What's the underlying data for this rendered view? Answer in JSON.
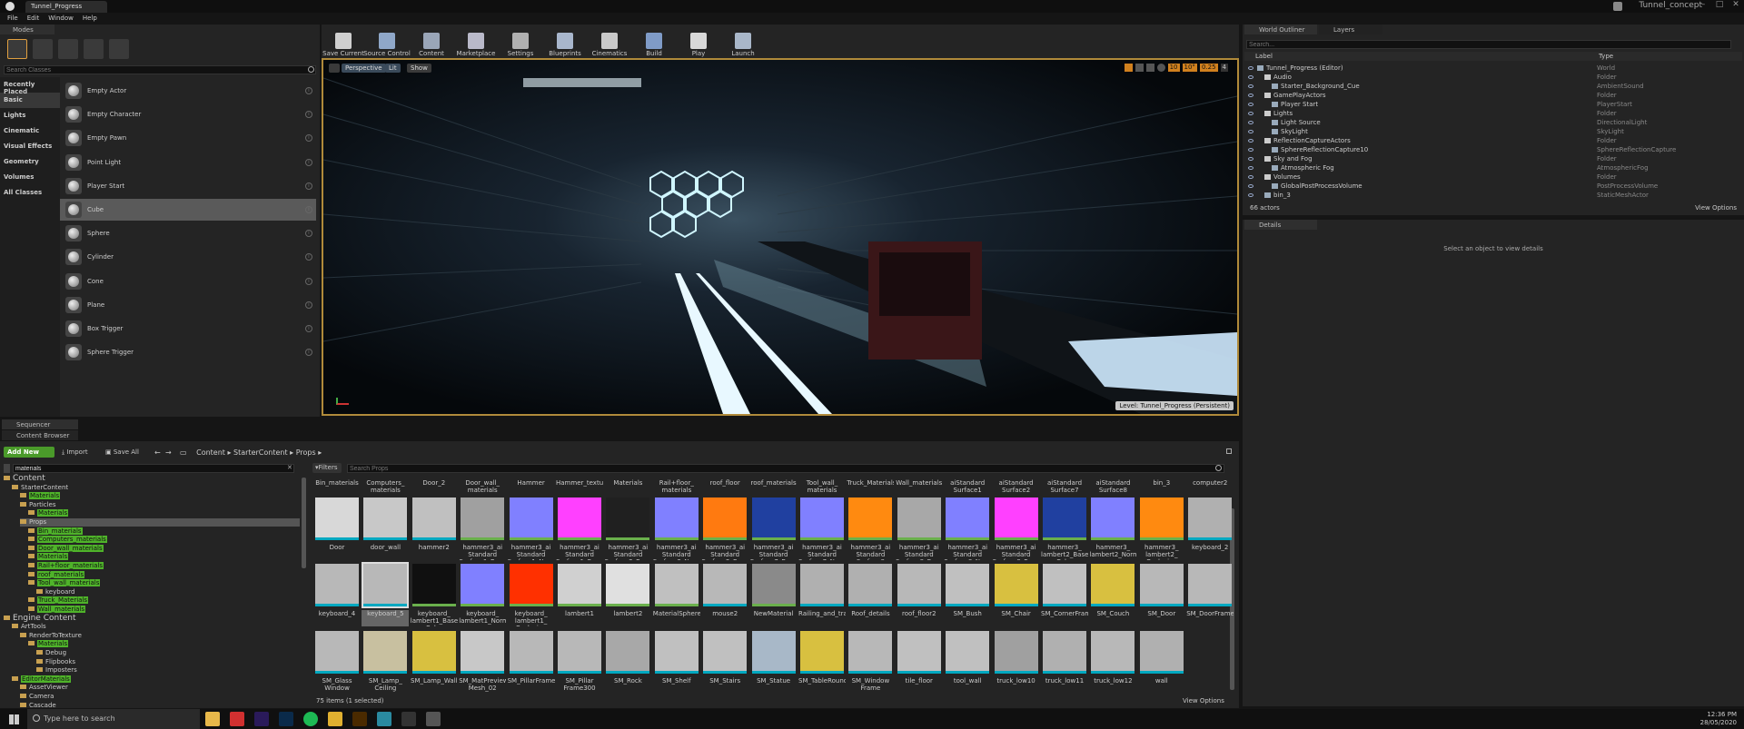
{
  "window": {
    "tab_title": "Tunnel_Progress",
    "project": "Tunnel_concept",
    "min": "–",
    "max": "□",
    "close": "✕"
  },
  "menu": [
    "File",
    "Edit",
    "Window",
    "Help"
  ],
  "modes": {
    "tab": "Modes",
    "search_placeholder": "Search Classes",
    "categories": [
      "Recently Placed",
      "Basic",
      "Lights",
      "Cinematic",
      "Visual Effects",
      "Geometry",
      "Volumes",
      "All Classes"
    ],
    "actors": [
      "Empty Actor",
      "Empty Character",
      "Empty Pawn",
      "Point Light",
      "Player Start",
      "Cube",
      "Sphere",
      "Cylinder",
      "Cone",
      "Plane",
      "Box Trigger",
      "Sphere Trigger"
    ]
  },
  "toolbar": [
    {
      "label": "Save Current",
      "color": "#cfcfcf"
    },
    {
      "label": "Source Control",
      "color": "#8fa7c8"
    },
    {
      "label": "Content",
      "color": "#9aa6b8"
    },
    {
      "label": "Marketplace",
      "color": "#b9b9c9"
    },
    {
      "label": "Settings",
      "color": "#b0b0b0"
    },
    {
      "label": "Blueprints",
      "color": "#a8b6cc"
    },
    {
      "label": "Cinematics",
      "color": "#c9c9c9"
    },
    {
      "label": "Build",
      "color": "#7f9bc7"
    },
    {
      "label": "Play",
      "color": "#d8d8d8"
    },
    {
      "label": "Launch",
      "color": "#a9b7c9"
    }
  ],
  "viewport": {
    "perspective": "Perspective",
    "lit": "Lit",
    "show": "Show",
    "level_label": "Level:",
    "level_name": "Tunnel_Progress (Persistent)",
    "snap": [
      "10",
      "10°",
      "0.25",
      "4"
    ]
  },
  "outliner": {
    "tab": "World Outliner",
    "tab2": "Layers",
    "search_placeholder": "Search...",
    "col_label": "Label",
    "col_type": "Type",
    "count": "66 actors",
    "view_options": "View Options",
    "rows": [
      {
        "label": "Tunnel_Progress (Editor)",
        "type": "World",
        "indent": 0
      },
      {
        "label": "Audio",
        "type": "Folder",
        "indent": 1
      },
      {
        "label": "Starter_Background_Cue",
        "type": "AmbientSound",
        "indent": 2
      },
      {
        "label": "GamePlayActors",
        "type": "Folder",
        "indent": 1
      },
      {
        "label": "Player Start",
        "type": "PlayerStart",
        "indent": 2
      },
      {
        "label": "Lights",
        "type": "Folder",
        "indent": 1
      },
      {
        "label": "Light Source",
        "type": "DirectionalLight",
        "indent": 2
      },
      {
        "label": "SkyLight",
        "type": "SkyLight",
        "indent": 2
      },
      {
        "label": "ReflectionCaptureActors",
        "type": "Folder",
        "indent": 1
      },
      {
        "label": "SphereReflectionCapture10",
        "type": "SphereReflectionCapture",
        "indent": 2
      },
      {
        "label": "Sky and Fog",
        "type": "Folder",
        "indent": 1
      },
      {
        "label": "Atmospheric Fog",
        "type": "AtmosphericFog",
        "indent": 2
      },
      {
        "label": "Volumes",
        "type": "Folder",
        "indent": 1
      },
      {
        "label": "GlobalPostProcessVolume",
        "type": "PostProcessVolume",
        "indent": 2
      },
      {
        "label": "bin_3",
        "type": "StaticMeshActor",
        "indent": 1
      }
    ]
  },
  "details": {
    "tab": "Details",
    "empty": "Select an object to view details"
  },
  "bottom_tabs": [
    "Sequencer",
    "Content Browser"
  ],
  "cb": {
    "add_new": "Add New",
    "import": "Import",
    "save_all": "Save All",
    "path": [
      "Content",
      "StarterContent",
      "Props"
    ],
    "filters": "Filters",
    "search_placeholder": "Search Props",
    "tree_search": "materials",
    "status": "75 items (1 selected)",
    "view_options": "View Options",
    "folders": [
      "Bin_materials",
      "Computers_ materials",
      "Door_2",
      "Door_wall_ materials",
      "Hammer",
      "Hammer_textures",
      "Materials",
      "Rail+floor_ materials",
      "roof_floor",
      "roof_materials",
      "Tool_wall_ materials",
      "Truck_Materials",
      "Wall_materials",
      "aiStandard Surface1",
      "aiStandard Surface2",
      "aiStandard Surface7",
      "aiStandard Surface8",
      "bin_3",
      "computer2"
    ]
  },
  "tree": [
    {
      "t": "Content",
      "lvl": 0,
      "big": true
    },
    {
      "t": "StarterContent",
      "lvl": 1
    },
    {
      "t": "Materials",
      "lvl": 2,
      "hl": true
    },
    {
      "t": "Particles",
      "lvl": 2
    },
    {
      "t": "Materials",
      "lvl": 3,
      "hl": true
    },
    {
      "t": "Props",
      "lvl": 2,
      "sel": true
    },
    {
      "t": "Bin_materials",
      "lvl": 3,
      "hl": true
    },
    {
      "t": "Computers_materials",
      "lvl": 3,
      "hl": true
    },
    {
      "t": "Door_wall_materials",
      "lvl": 3,
      "hl": true
    },
    {
      "t": "Materials",
      "lvl": 3,
      "hl": true
    },
    {
      "t": "Rail+floor_materials",
      "lvl": 3,
      "hl": true
    },
    {
      "t": "roof_materials",
      "lvl": 3,
      "hl": true
    },
    {
      "t": "Tool_wall_materials",
      "lvl": 3,
      "hl": true
    },
    {
      "t": "keyboard",
      "lvl": 4
    },
    {
      "t": "Truck_Materials",
      "lvl": 3,
      "hl": true
    },
    {
      "t": "Wall_materials",
      "lvl": 3,
      "hl": true
    },
    {
      "t": "Engine Content",
      "lvl": 0,
      "big": true
    },
    {
      "t": "ArtTools",
      "lvl": 1
    },
    {
      "t": "RenderToTexture",
      "lvl": 2
    },
    {
      "t": "Materials",
      "lvl": 3,
      "hl": true
    },
    {
      "t": "Debug",
      "lvl": 4
    },
    {
      "t": "Flipbooks",
      "lvl": 4
    },
    {
      "t": "Imposters",
      "lvl": 4
    },
    {
      "t": "EditorMaterials",
      "lvl": 1,
      "hl": true
    },
    {
      "t": "AssetViewer",
      "lvl": 2
    },
    {
      "t": "Camera",
      "lvl": 2
    },
    {
      "t": "Cascade",
      "lvl": 2
    },
    {
      "t": "Cloth",
      "lvl": 2
    }
  ],
  "assets": [
    {
      "row": 0,
      "items": [
        {
          "n": "Door",
          "c": "#d8d8d8",
          "b": "#00a8c0"
        },
        {
          "n": "door_wall",
          "c": "#c8c8c8",
          "b": "#00a8c0"
        },
        {
          "n": "hammer2",
          "c": "#c0c0c0",
          "b": "#00a8c0"
        },
        {
          "n": "hammer3_ai Standard Surface1_Base",
          "c": "#a0a0a0",
          "b": "#6ab04c"
        },
        {
          "n": "hammer3_ai Standard Surface1_Normal",
          "c": "#8080ff",
          "b": "#6ab04c"
        },
        {
          "n": "hammer3_ai Standard Surface1_Rough",
          "c": "#ff40ff",
          "b": "#6ab04c"
        },
        {
          "n": "hammer3_ai Standard Surface2_Base",
          "c": "#202020",
          "b": "#6ab04c"
        },
        {
          "n": "hammer3_ai Standard Surface2_Normal",
          "c": "#8080ff",
          "b": "#6ab04c"
        },
        {
          "n": "hammer3_ai Standard Surface2_Base",
          "c": "#ff7a10",
          "b": "#6ab04c"
        },
        {
          "n": "hammer3_ai Standard Surface7_Base",
          "c": "#2040a0",
          "b": "#6ab04c"
        },
        {
          "n": "hammer3_ai Standard Surface7_Normal",
          "c": "#8080ff",
          "b": "#6ab04c"
        },
        {
          "n": "hammer3_ai Standard Surface8",
          "c": "#ff8a10",
          "b": "#6ab04c"
        },
        {
          "n": "hammer3_ai Standard Surface8_Base",
          "c": "#a8a8a8",
          "b": "#6ab04c"
        },
        {
          "n": "hammer3_ai Standard Surface8_Normal",
          "c": "#8080ff",
          "b": "#6ab04c"
        },
        {
          "n": "hammer3_ai Standard Surface8_Rough",
          "c": "#ff40ff",
          "b": "#6ab04c"
        },
        {
          "n": "hammer3_ lambert2_Base Color",
          "c": "#2040a0",
          "b": "#6ab04c"
        },
        {
          "n": "hammer3_ lambert2_Normal",
          "c": "#8080ff",
          "b": "#6ab04c"
        },
        {
          "n": "hammer3_ lambert2_ Occlusion",
          "c": "#ff8a10",
          "b": "#6ab04c"
        },
        {
          "n": "keyboard_2",
          "c": "#b0b0b0",
          "b": "#00a8c0"
        }
      ]
    },
    {
      "row": 1,
      "items": [
        {
          "n": "keyboard_4",
          "c": "#b8b8b8",
          "b": "#00a8c0"
        },
        {
          "n": "keyboard_5",
          "c": "#b8b8b8",
          "b": "#00a8c0",
          "sel": true
        },
        {
          "n": "keyboard_ lambert1_Base Color",
          "c": "#101010",
          "b": "#6ab04c"
        },
        {
          "n": "keyboard_ lambert1_Normal",
          "c": "#8080ff",
          "b": "#6ab04c"
        },
        {
          "n": "keyboard_ lambert1_ Occlusion",
          "c": "#ff3000",
          "b": "#6ab04c"
        },
        {
          "n": "lambert1",
          "c": "#d0d0d0",
          "b": "#6ab04c"
        },
        {
          "n": "lambert2",
          "c": "#e0e0e0",
          "b": "#6ab04c"
        },
        {
          "n": "MaterialSphere",
          "c": "#c0c0c0",
          "b": "#6ab04c"
        },
        {
          "n": "mouse2",
          "c": "#b8b8b8",
          "b": "#00a8c0"
        },
        {
          "n": "NewMaterial",
          "c": "#8a8a8a",
          "b": "#6ab04c"
        },
        {
          "n": "Railing_and_trail",
          "c": "#b0b0b0",
          "b": "#00a8c0"
        },
        {
          "n": "Roof_details",
          "c": "#b0b0b0",
          "b": "#00a8c0"
        },
        {
          "n": "roof_floor2",
          "c": "#b8b8b8",
          "b": "#00a8c0"
        },
        {
          "n": "SM_Bush",
          "c": "#c0c0c0",
          "b": "#00a8c0"
        },
        {
          "n": "SM_Chair",
          "c": "#d8c040",
          "b": "#00a8c0"
        },
        {
          "n": "SM_CornerFrame",
          "c": "#c0c0c0",
          "b": "#00a8c0"
        },
        {
          "n": "SM_Couch",
          "c": "#d8c040",
          "b": "#00a8c0"
        },
        {
          "n": "SM_Door",
          "c": "#b8b8b8",
          "b": "#00a8c0"
        },
        {
          "n": "SM_DoorFrame",
          "c": "#b8b8b8",
          "b": "#00a8c0"
        }
      ]
    },
    {
      "row": 2,
      "items": [
        {
          "n": "SM_Glass Window",
          "c": "#b8b8b8",
          "b": "#00a8c0"
        },
        {
          "n": "SM_Lamp_ Ceiling",
          "c": "#c8c0a0",
          "b": "#00a8c0"
        },
        {
          "n": "SM_Lamp_Wall",
          "c": "#d8c040",
          "b": "#00a8c0"
        },
        {
          "n": "SM_MatPreview Mesh_02",
          "c": "#c8c8c8",
          "b": "#00a8c0"
        },
        {
          "n": "SM_PillarFrame",
          "c": "#b8b8b8",
          "b": "#00a8c0"
        },
        {
          "n": "SM_Pillar Frame300",
          "c": "#b8b8b8",
          "b": "#00a8c0"
        },
        {
          "n": "SM_Rock",
          "c": "#a8a8a8",
          "b": "#00a8c0"
        },
        {
          "n": "SM_Shelf",
          "c": "#c0c0c0",
          "b": "#00a8c0"
        },
        {
          "n": "SM_Stairs",
          "c": "#c0c0c0",
          "b": "#00a8c0"
        },
        {
          "n": "SM_Statue",
          "c": "#a8b8c8",
          "b": "#00a8c0"
        },
        {
          "n": "SM_TableRound",
          "c": "#d8c040",
          "b": "#00a8c0"
        },
        {
          "n": "SM_Window Frame",
          "c": "#b8b8b8",
          "b": "#00a8c0"
        },
        {
          "n": "tile_floor",
          "c": "#c0c0c0",
          "b": "#00a8c0"
        },
        {
          "n": "tool_wall",
          "c": "#c0c0c0",
          "b": "#00a8c0"
        },
        {
          "n": "truck_low10",
          "c": "#a0a0a0",
          "b": "#00a8c0"
        },
        {
          "n": "truck_low11",
          "c": "#b0b0b0",
          "b": "#00a8c0"
        },
        {
          "n": "truck_low12",
          "c": "#b8b8b8",
          "b": "#00a8c0"
        },
        {
          "n": "wall",
          "c": "#b0b0b0",
          "b": "#00a8c0"
        }
      ]
    }
  ],
  "taskbar": {
    "search": "Type here to search",
    "time": "12:36 PM",
    "date": "28/05/2020",
    "apps": [
      {
        "name": "file-explorer-icon",
        "c": "#e8b84a"
      },
      {
        "name": "app-icon-red",
        "c": "#d03030"
      },
      {
        "name": "after-effects-icon",
        "c": "#2a1a5a"
      },
      {
        "name": "photoshop-icon",
        "c": "#0a2a4a"
      },
      {
        "name": "spotify-icon",
        "c": "#1db954"
      },
      {
        "name": "chrome-icon",
        "c": "#e0b030"
      },
      {
        "name": "illustrator-icon",
        "c": "#4a2a00"
      },
      {
        "name": "maya-icon",
        "c": "#2a8aa0"
      },
      {
        "name": "unreal-launcher-icon",
        "c": "#333"
      },
      {
        "name": "unreal-editor-icon",
        "c": "#555"
      }
    ]
  }
}
